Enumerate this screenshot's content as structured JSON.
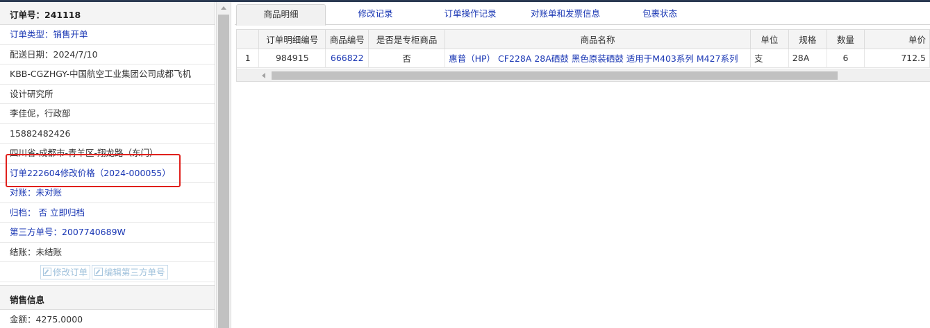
{
  "order": {
    "header": "订单号：241118",
    "rows": [
      {
        "text": "订单类型：销售开单",
        "blue": true
      },
      {
        "text": "配送日期：2024/7/10",
        "blue": false
      },
      {
        "text": "KBB-CGZHGY-中国航空工业集团公司成都飞机",
        "blue": false
      },
      {
        "text": "设计研究所",
        "blue": false
      },
      {
        "text": "李佳伲，行政部",
        "blue": false
      },
      {
        "text": "15882482426",
        "blue": false
      },
      {
        "text": "四川省-成都市-青羊区-翔龙路（东门）",
        "blue": false
      },
      {
        "text": "订单222604修改价格（2024-000055）",
        "blue": true
      },
      {
        "text": "对账：未对账",
        "blue": true
      },
      {
        "text": "归档： 否 立即归档",
        "blue": true
      },
      {
        "text": "第三方单号：2007740689W",
        "blue": true
      },
      {
        "text": "结账：未结账",
        "blue": false
      }
    ],
    "edit_order_label": "修改订单",
    "edit_third_party_label": "编辑第三方单号"
  },
  "sales": {
    "header": "销售信息",
    "amount": "金额：4275.0000"
  },
  "tabs": [
    "商品明细",
    "修改记录",
    "订单操作记录",
    "对账单和发票信息",
    "包裹状态"
  ],
  "grid": {
    "columns": [
      "",
      "订单明细编号",
      "商品编号",
      "是否是专柜商品",
      "商品名称",
      "单位",
      "规格",
      "数量",
      "单价"
    ],
    "rows": [
      [
        "1",
        "984915",
        "666822",
        "否",
        "惠普（HP） CF228A 28A硒鼓 黑色原装硒鼓 适用于M403系列 M427系列",
        "支",
        "28A",
        "6",
        "712.5"
      ]
    ]
  }
}
